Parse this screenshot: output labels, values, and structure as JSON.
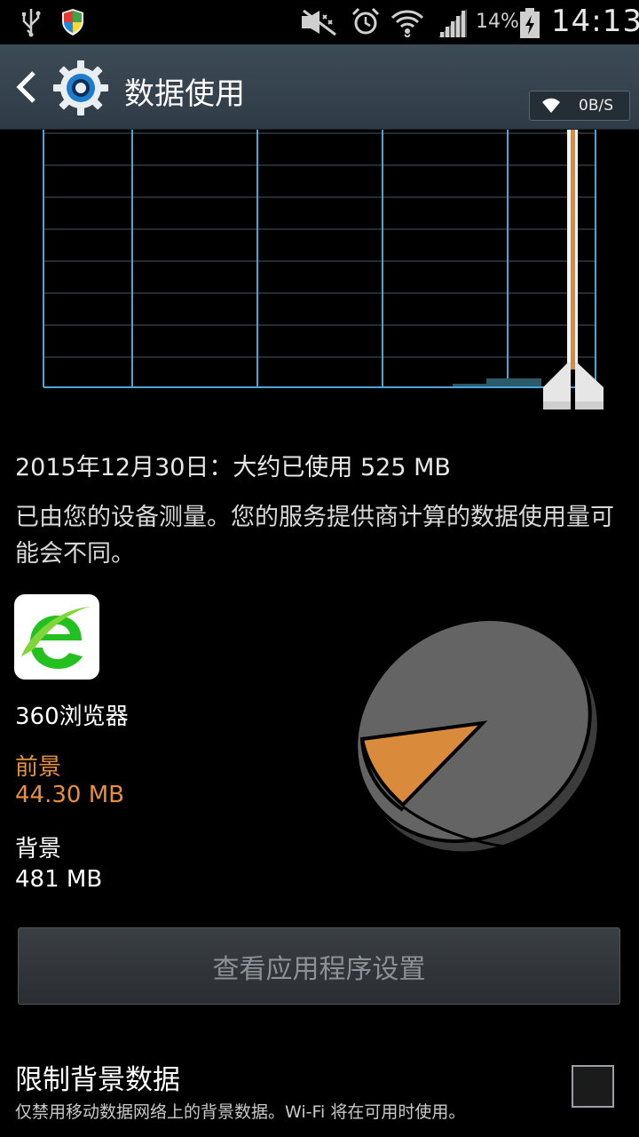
{
  "status_bar": {
    "battery_percent": "14%",
    "time": "14:13",
    "icons": [
      "usb-icon",
      "security-shield-icon",
      "mute-icon",
      "alarm-icon",
      "wifi-icon",
      "signal-icon",
      "battery-icon"
    ]
  },
  "action_bar": {
    "title": "数据使用",
    "speed": "0B/S"
  },
  "usage": {
    "summary": "2015年12月30日：大约已使用 525 MB",
    "note": "已由您的设备测量。您的服务提供商计算的数据使用量可能会不同。"
  },
  "app": {
    "name": "360浏览器",
    "foreground_label": "前景",
    "foreground_value": "44.30 MB",
    "background_label": "背景",
    "background_value": "481 MB"
  },
  "view_settings_button": "查看应用程序设置",
  "restrict": {
    "title": "限制背景数据",
    "description": "仅禁用移动数据网络上的背景数据。Wi-Fi 将在可用时使用。",
    "checked": false
  },
  "colors": {
    "foreground": "#e5903f",
    "background_slice": "#646464",
    "grid": "#4aa6d8",
    "actionbar": "#34424d"
  }
}
